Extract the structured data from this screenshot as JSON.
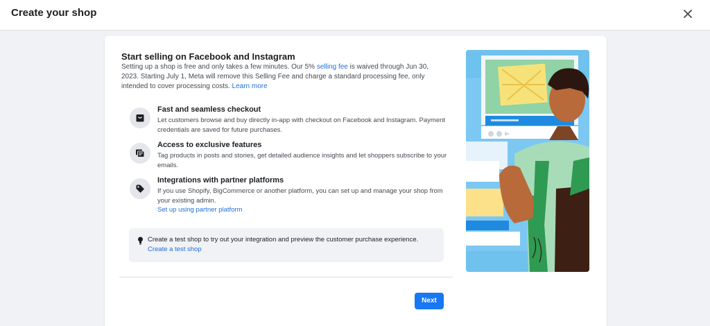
{
  "header": {
    "title": "Create your shop",
    "close_icon": "close-icon"
  },
  "intro": {
    "heading": "Start selling on Facebook and Instagram",
    "text_before_link": "Setting up a shop is free and only takes a few minutes. Our 5% ",
    "selling_fee_link": "selling fee",
    "text_after_link": " is waived through Jun 30, 2023. Starting July 1, Meta will remove this Selling Fee and charge a standard processing fee, only intended to cover processing costs. ",
    "learn_more_link": "Learn more"
  },
  "features": [
    {
      "icon": "shopping-bag-icon",
      "title": "Fast and seamless checkout",
      "description": "Let customers browse and buy directly in-app with checkout on Facebook and Instagram. Payment credentials are saved for future purchases."
    },
    {
      "icon": "cards-icon",
      "title": "Access to exclusive features",
      "description": "Tag products in posts and stories, get detailed audience insights and let shoppers subscribe to your emails."
    },
    {
      "icon": "tag-icon",
      "title": "Integrations with partner platforms",
      "description": "If you use Shopify, BigCommerce or another platform, you can set up and manage your shop from your existing admin.",
      "link": "Set up using partner platform"
    }
  ],
  "test_shop": {
    "icon": "lightbulb-icon",
    "text": "Create a test shop to try out your integration and preview the customer purchase experience.",
    "link": "Create a test shop"
  },
  "footer": {
    "next_label": "Next"
  },
  "colors": {
    "accent": "#1877f2",
    "link": "#216fdb",
    "page_bg": "#f0f2f5"
  }
}
